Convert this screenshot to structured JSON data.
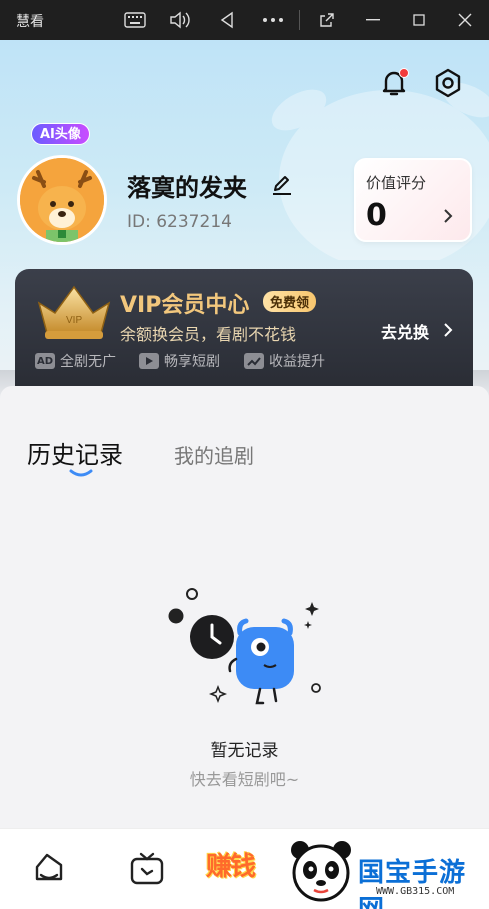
{
  "titlebar": {
    "app_title": "慧看",
    "buttons": [
      "keyboard-icon",
      "volume-icon",
      "back-icon",
      "more-icon",
      "popout-icon",
      "minimize-icon",
      "maximize-icon",
      "close-icon"
    ]
  },
  "profile": {
    "ai_badge": "AI头像",
    "nickname": "落寞的发夹",
    "user_id": "ID: 6237214",
    "score_label": "价值评分",
    "score_value": "0"
  },
  "vip": {
    "title": "VIP会员中心",
    "free_tag": "免费领",
    "subtitle": "余额换会员，看剧不花钱",
    "redeem": "去兑换",
    "perks": [
      {
        "icon": "AD",
        "label": "全剧无广"
      },
      {
        "icon": "play-icon",
        "label": "畅享短剧"
      },
      {
        "icon": "trend-icon",
        "label": "收益提升"
      }
    ]
  },
  "tabs": {
    "history": "历史记录",
    "following": "我的追剧"
  },
  "empty": {
    "title": "暂无记录",
    "subtitle": "快去看短剧吧~"
  },
  "bottom_nav": {
    "earn_label": "赚钱"
  },
  "watermark": {
    "text": "国宝手游网",
    "url": "WWW.GB315.COM"
  },
  "colors": {
    "accent_blue": "#3d8bf5",
    "vip_gold": "#f2c77d",
    "notification_red": "#f23b3b"
  }
}
